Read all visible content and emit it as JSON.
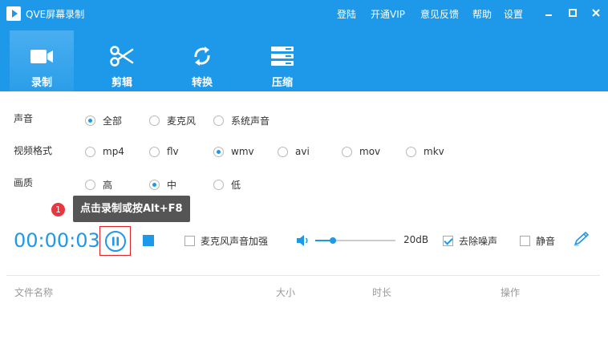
{
  "window": {
    "title": "QVE屏幕录制",
    "links": [
      "登陆",
      "开通VIP",
      "意见反馈",
      "帮助",
      "设置"
    ]
  },
  "tabs": [
    {
      "label": "录制",
      "icon": "video-camera-icon",
      "active": true
    },
    {
      "label": "剪辑",
      "icon": "scissors-icon",
      "active": false
    },
    {
      "label": "转换",
      "icon": "convert-icon",
      "active": false
    },
    {
      "label": "压缩",
      "icon": "compress-icon",
      "active": false
    }
  ],
  "settings": {
    "audio": {
      "label": "声音",
      "options": [
        "全部",
        "麦克风",
        "系统声音"
      ],
      "selected": "全部"
    },
    "format": {
      "label": "视频格式",
      "options": [
        "mp4",
        "flv",
        "wmv",
        "avi",
        "mov",
        "mkv"
      ],
      "selected": "wmv"
    },
    "quality": {
      "label": "画质",
      "options": [
        "高",
        "中",
        "低"
      ],
      "selected": "中"
    }
  },
  "tooltip": {
    "step": "1",
    "text": "点击录制或按Alt+F8"
  },
  "recorder": {
    "timer": "00:00:03",
    "mic_boost_label": "麦克风声音加强",
    "mic_boost_checked": false,
    "volume_fraction": 0.22,
    "volume_value": "20dB",
    "denoise_label": "去除噪声",
    "denoise_checked": true,
    "mute_label": "静音",
    "mute_checked": false
  },
  "file_table": {
    "columns": [
      "文件名称",
      "大小",
      "时长",
      "操作"
    ]
  },
  "colors": {
    "accent": "#1e98e8",
    "highlight_frame": "#e02424",
    "badge": "#e8353e"
  }
}
